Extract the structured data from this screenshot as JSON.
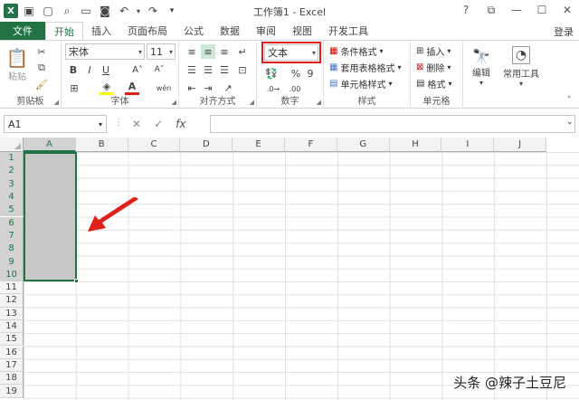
{
  "titlebar": {
    "title": "工作簿1 - Excel",
    "help": "?",
    "restore_ribbon": "⧉",
    "minimize": "—",
    "maximize": "☐",
    "close": "✕"
  },
  "tabs": [
    "文件",
    "开始",
    "插入",
    "页面布局",
    "公式",
    "数据",
    "审阅",
    "视图",
    "开发工具"
  ],
  "active_tab": "开始",
  "login": "登录",
  "ribbon": {
    "clipboard": {
      "paste": "粘贴",
      "label": "剪贴板"
    },
    "font": {
      "name": "宋体",
      "size": "11",
      "bold": "B",
      "italic": "I",
      "underline": "U",
      "grow": "A˄",
      "shrink": "A˅",
      "color_a": "A",
      "wen": "wén",
      "label": "字体"
    },
    "alignment": {
      "label": "对齐方式"
    },
    "number": {
      "format": "文本",
      "percent": "%",
      "comma": "9",
      "label": "数字"
    },
    "styles": {
      "conditional": "条件格式",
      "table": "套用表格格式",
      "cell": "单元格样式",
      "label": "样式"
    },
    "cells": {
      "insert": "插入",
      "delete": "删除",
      "format": "格式",
      "label": "单元格"
    },
    "editing": {
      "label": "编辑"
    },
    "common_tools": {
      "label": "常用工具"
    }
  },
  "formula_bar": {
    "name_box": "A1",
    "cancel": "✕",
    "enter": "✓",
    "fx": "fx",
    "value": ""
  },
  "grid": {
    "columns": [
      "A",
      "B",
      "C",
      "D",
      "E",
      "F",
      "G",
      "H",
      "I",
      "J"
    ],
    "rows": [
      "1",
      "2",
      "3",
      "4",
      "5",
      "6",
      "7",
      "8",
      "9",
      "10",
      "11",
      "12",
      "13",
      "14",
      "15",
      "16",
      "17",
      "18",
      "19"
    ],
    "selected_column": "A",
    "selected_rows": [
      "1",
      "2",
      "3",
      "4",
      "5",
      "6",
      "7",
      "8",
      "9",
      "10"
    ]
  },
  "colors": {
    "accent": "#217346",
    "highlight_box": "#e0201a",
    "arrow": "#e0201a"
  },
  "watermark": "头条 @辣子土豆尼"
}
